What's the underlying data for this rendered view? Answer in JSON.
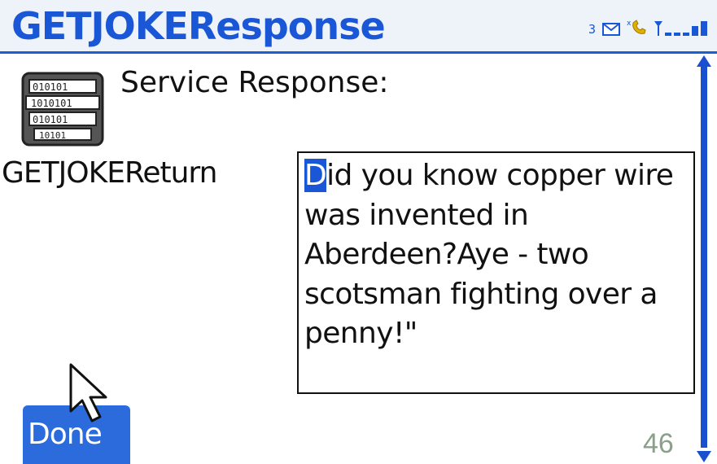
{
  "window": {
    "title": "GETJOKEResponse"
  },
  "status_bar": {
    "message_count": "3"
  },
  "content": {
    "heading": "Service Response:",
    "field_label": "GETJOKEReturn",
    "field_value_first_char": "D",
    "field_value_rest": "id you know copper wire was invented in Aberdeen?Aye - two scotsman fighting over a penny!\""
  },
  "done_button": {
    "label": "Done"
  },
  "slide": {
    "page_number": "46"
  },
  "colors": {
    "accent": "#1a57d6",
    "button": "#2b6bdc",
    "text": "#111111"
  }
}
